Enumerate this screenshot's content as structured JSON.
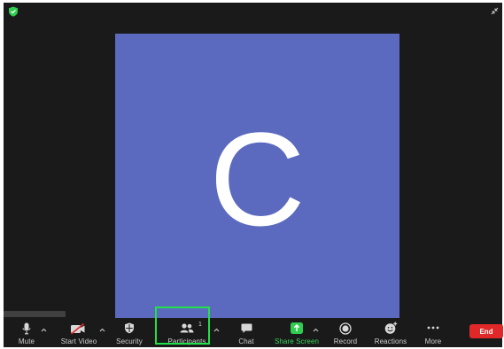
{
  "meeting": {
    "avatar_initial": "C",
    "participant_count": "1"
  },
  "colors": {
    "tile_background": "#5b6abf",
    "share_green": "#2ecc4f",
    "end_red": "#e02828",
    "highlight_green": "#22e04a"
  },
  "toolbar": {
    "mute_label": "Mute",
    "start_video_label": "Start Video",
    "security_label": "Security",
    "participants_label": "Participants",
    "chat_label": "Chat",
    "share_screen_label": "Share Screen",
    "record_label": "Record",
    "reactions_label": "Reactions",
    "more_label": "More",
    "end_label": "End"
  },
  "icons": {
    "encryption": "shield-check-icon",
    "exit_fullscreen": "exit-fullscreen-icon",
    "mute": "microphone-icon",
    "video": "video-off-icon",
    "security": "shield-icon",
    "participants": "people-icon",
    "chat": "chat-bubble-icon",
    "share": "share-arrow-icon",
    "record": "record-icon",
    "reactions": "emoji-add-icon",
    "more": "ellipsis-icon"
  }
}
